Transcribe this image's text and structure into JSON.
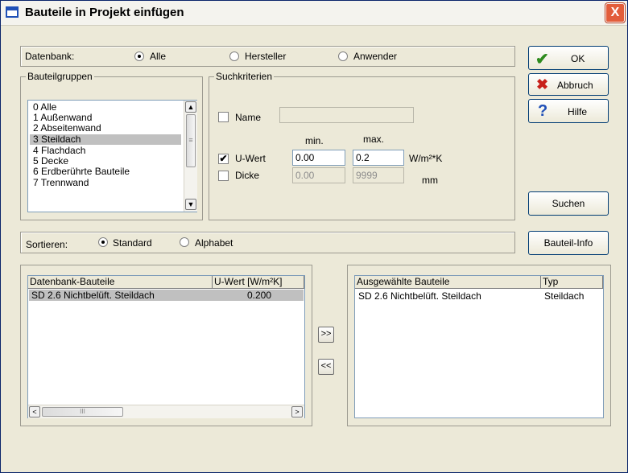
{
  "window": {
    "title": "Bauteile in Projekt einfügen",
    "close_glyph": "X"
  },
  "datenbank": {
    "label": "Datenbank:",
    "options": [
      {
        "label": "Alle",
        "selected": true
      },
      {
        "label": "Hersteller",
        "selected": false
      },
      {
        "label": "Anwender",
        "selected": false
      }
    ]
  },
  "bauteilgruppen": {
    "legend": "Bauteilgruppen",
    "items": [
      "0 Alle",
      "1 Außenwand",
      "2 Abseitenwand",
      "3 Steildach",
      "4 Flachdach",
      "5 Decke",
      "6 Erdberührte Bauteile",
      "7 Trennwand"
    ],
    "selected_index": 3
  },
  "suchkriterien": {
    "legend": "Suchkriterien",
    "name": {
      "label": "Name",
      "checked": false,
      "value": ""
    },
    "min_label": "min.",
    "max_label": "max.",
    "uwert": {
      "label": "U-Wert",
      "checked": true,
      "check_glyph": "✔",
      "min": "0.00",
      "max": "0.2",
      "unit": "W/m²*K"
    },
    "dicke": {
      "label": "Dicke",
      "checked": false,
      "min": "0.00",
      "max": "9999",
      "unit": "mm"
    }
  },
  "buttons": {
    "ok": "OK",
    "abbruch": "Abbruch",
    "hilfe": "Hilfe",
    "suchen": "Suchen",
    "bauteil_info": "Bauteil-Info"
  },
  "icons": {
    "ok": "checkmark-icon",
    "abbruch": "x-icon",
    "hilfe": "question-mark-icon"
  },
  "icon_glyphs": {
    "ok": "✔",
    "abbruch": "✖",
    "hilfe": "?"
  },
  "colors": {
    "ok_icon": "#2e8b1e",
    "abbruch_icon": "#c8201a",
    "hilfe_icon": "#1f4fb7",
    "title_border": "#0a246a"
  },
  "sortieren": {
    "label": "Sortieren:",
    "options": [
      {
        "label": "Standard",
        "selected": true
      },
      {
        "label": "Alphabet",
        "selected": false
      }
    ]
  },
  "datenbank_bauteile": {
    "headers": [
      "Datenbank-Bauteile",
      "U-Wert [W/m²K]"
    ],
    "rows": [
      {
        "name": "SD 2.6 Nichtbelüft. Steildach",
        "uwert": "0.200"
      }
    ],
    "scroll_left_glyph": "<",
    "scroll_right_glyph": ">",
    "thumb_grip": "III"
  },
  "ausgewaehlte_bauteile": {
    "headers": [
      "Ausgewählte Bauteile",
      "Typ"
    ],
    "rows": [
      {
        "name": "SD 2.6 Nichtbelüft. Steildach",
        "typ": "Steildach"
      }
    ]
  },
  "move_buttons": {
    "add": ">>",
    "remove": "<<"
  },
  "scroll_glyphs": {
    "up": "▲",
    "down": "▼",
    "grip": "≡"
  }
}
